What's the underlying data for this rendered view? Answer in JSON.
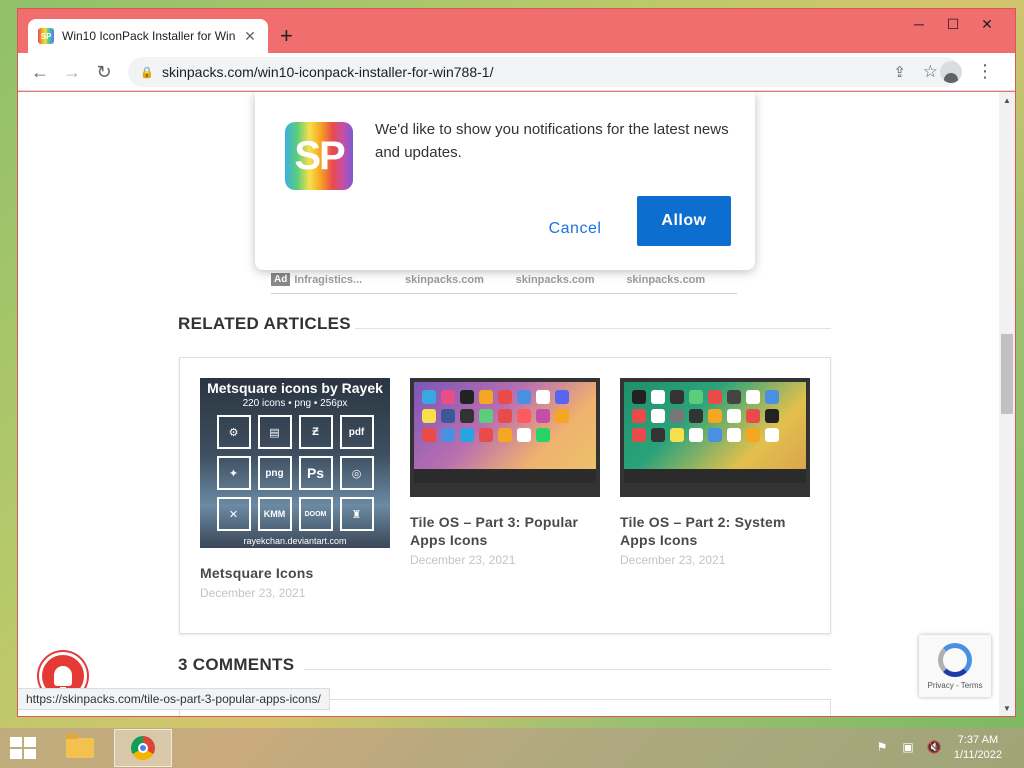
{
  "browser": {
    "tab_title": "Win10 IconPack Installer for Win",
    "tab_favicon_text": "SP",
    "new_tab_label": "+",
    "url": "skinpacks.com/win10-iconpack-installer-for-win788-1/",
    "minimize_label": "─",
    "maximize_label": "☐",
    "close_label": "✕",
    "back_label": "←",
    "forward_label": "→",
    "reload_label": "↻",
    "menu_label": "⋮",
    "status_url": "https://skinpacks.com/tile-os-part-3-popular-apps-icons/"
  },
  "notification": {
    "logo_text": "SP",
    "message": "We'd like to show you notifications for the latest news and updates.",
    "cancel_label": "Cancel",
    "allow_label": "Allow"
  },
  "ads": {
    "badge": "Ad",
    "items": [
      "Infragistics...",
      "skinpacks.com",
      "skinpacks.com",
      "skinpacks.com"
    ]
  },
  "related": {
    "heading": "RELATED ARTICLES",
    "articles": [
      {
        "title": "Metsquare Icons",
        "date": "December 23, 2021",
        "thumb_heading": "Metsquare icons by Rayek",
        "thumb_sub": "220 icons • png • 256px",
        "thumb_cells": [
          "⚙",
          "▤",
          "Ƶ",
          "pdf",
          "✦",
          "png",
          "Ps",
          "◎",
          "✕",
          "KMM",
          "DOOM",
          "♜"
        ],
        "thumb_footer": "rayekchan.deviantart.com"
      },
      {
        "title": "Tile OS – Part 3: Popular Apps Icons",
        "date": "December 23, 2021"
      },
      {
        "title": "Tile OS – Part 2: System Apps Icons",
        "date": "December 23, 2021"
      }
    ]
  },
  "comments": {
    "heading": "3 COMMENTS"
  },
  "recaptcha": {
    "text": "Privacy - Terms"
  },
  "taskbar": {
    "time": "7:37 AM",
    "date": "1/11/2022"
  },
  "colors": {
    "window_frame": "#f06e6e",
    "allow_button": "#0c6fcf",
    "bell": "#e53935"
  }
}
